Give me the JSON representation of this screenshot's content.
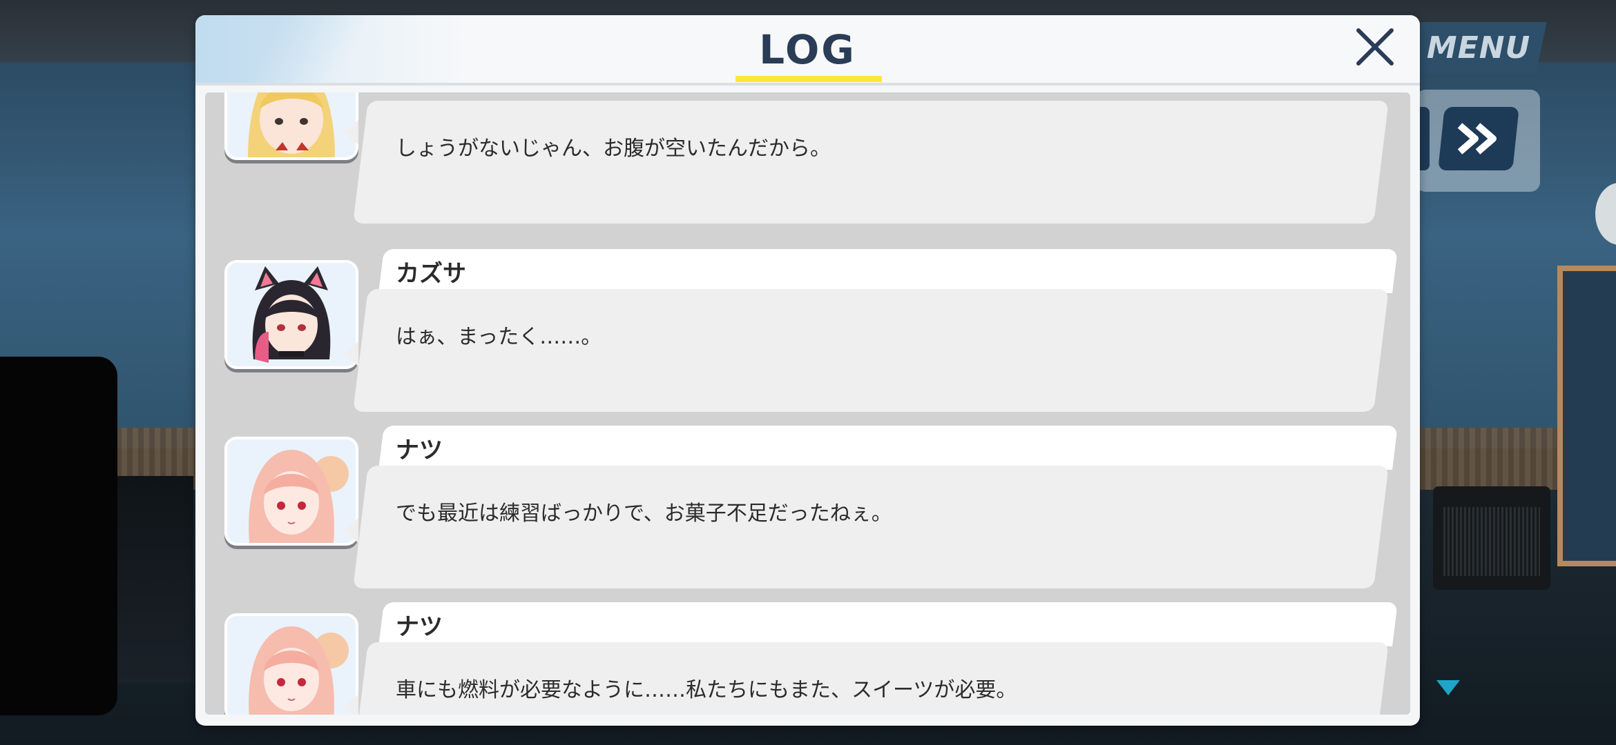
{
  "dialog": {
    "title": "LOG",
    "close_icon": "close-icon"
  },
  "side_controls": {
    "menu_label": "MENU",
    "fast_forward_icon": "fast-forward-icon",
    "scroll_down_icon": "triangle-down-icon"
  },
  "log_entries": [
    {
      "speaker": "",
      "text": "しょうがないじゃん、お腹が空いたんだから。",
      "avatar": "blonde-girl-avatar"
    },
    {
      "speaker": "カズサ",
      "text": "はぁ、まったく……。",
      "avatar": "black-hair-cat-ear-girl-avatar"
    },
    {
      "speaker": "ナツ",
      "text": "でも最近は練習ばっかりで、お菓子不足だったねぇ。",
      "avatar": "pink-hair-girl-avatar"
    },
    {
      "speaker": "ナツ",
      "text": "車にも燃料が必要なように……私たちにもまた、スイーツが必要。",
      "avatar": "pink-hair-girl-avatar"
    }
  ],
  "colors": {
    "title_text": "#2a3c56",
    "title_underline": "#ffe833",
    "menu_button": "#2d4f69",
    "ff_button": "#1d3a57",
    "scroll_indicator": "#1ea5c7"
  }
}
